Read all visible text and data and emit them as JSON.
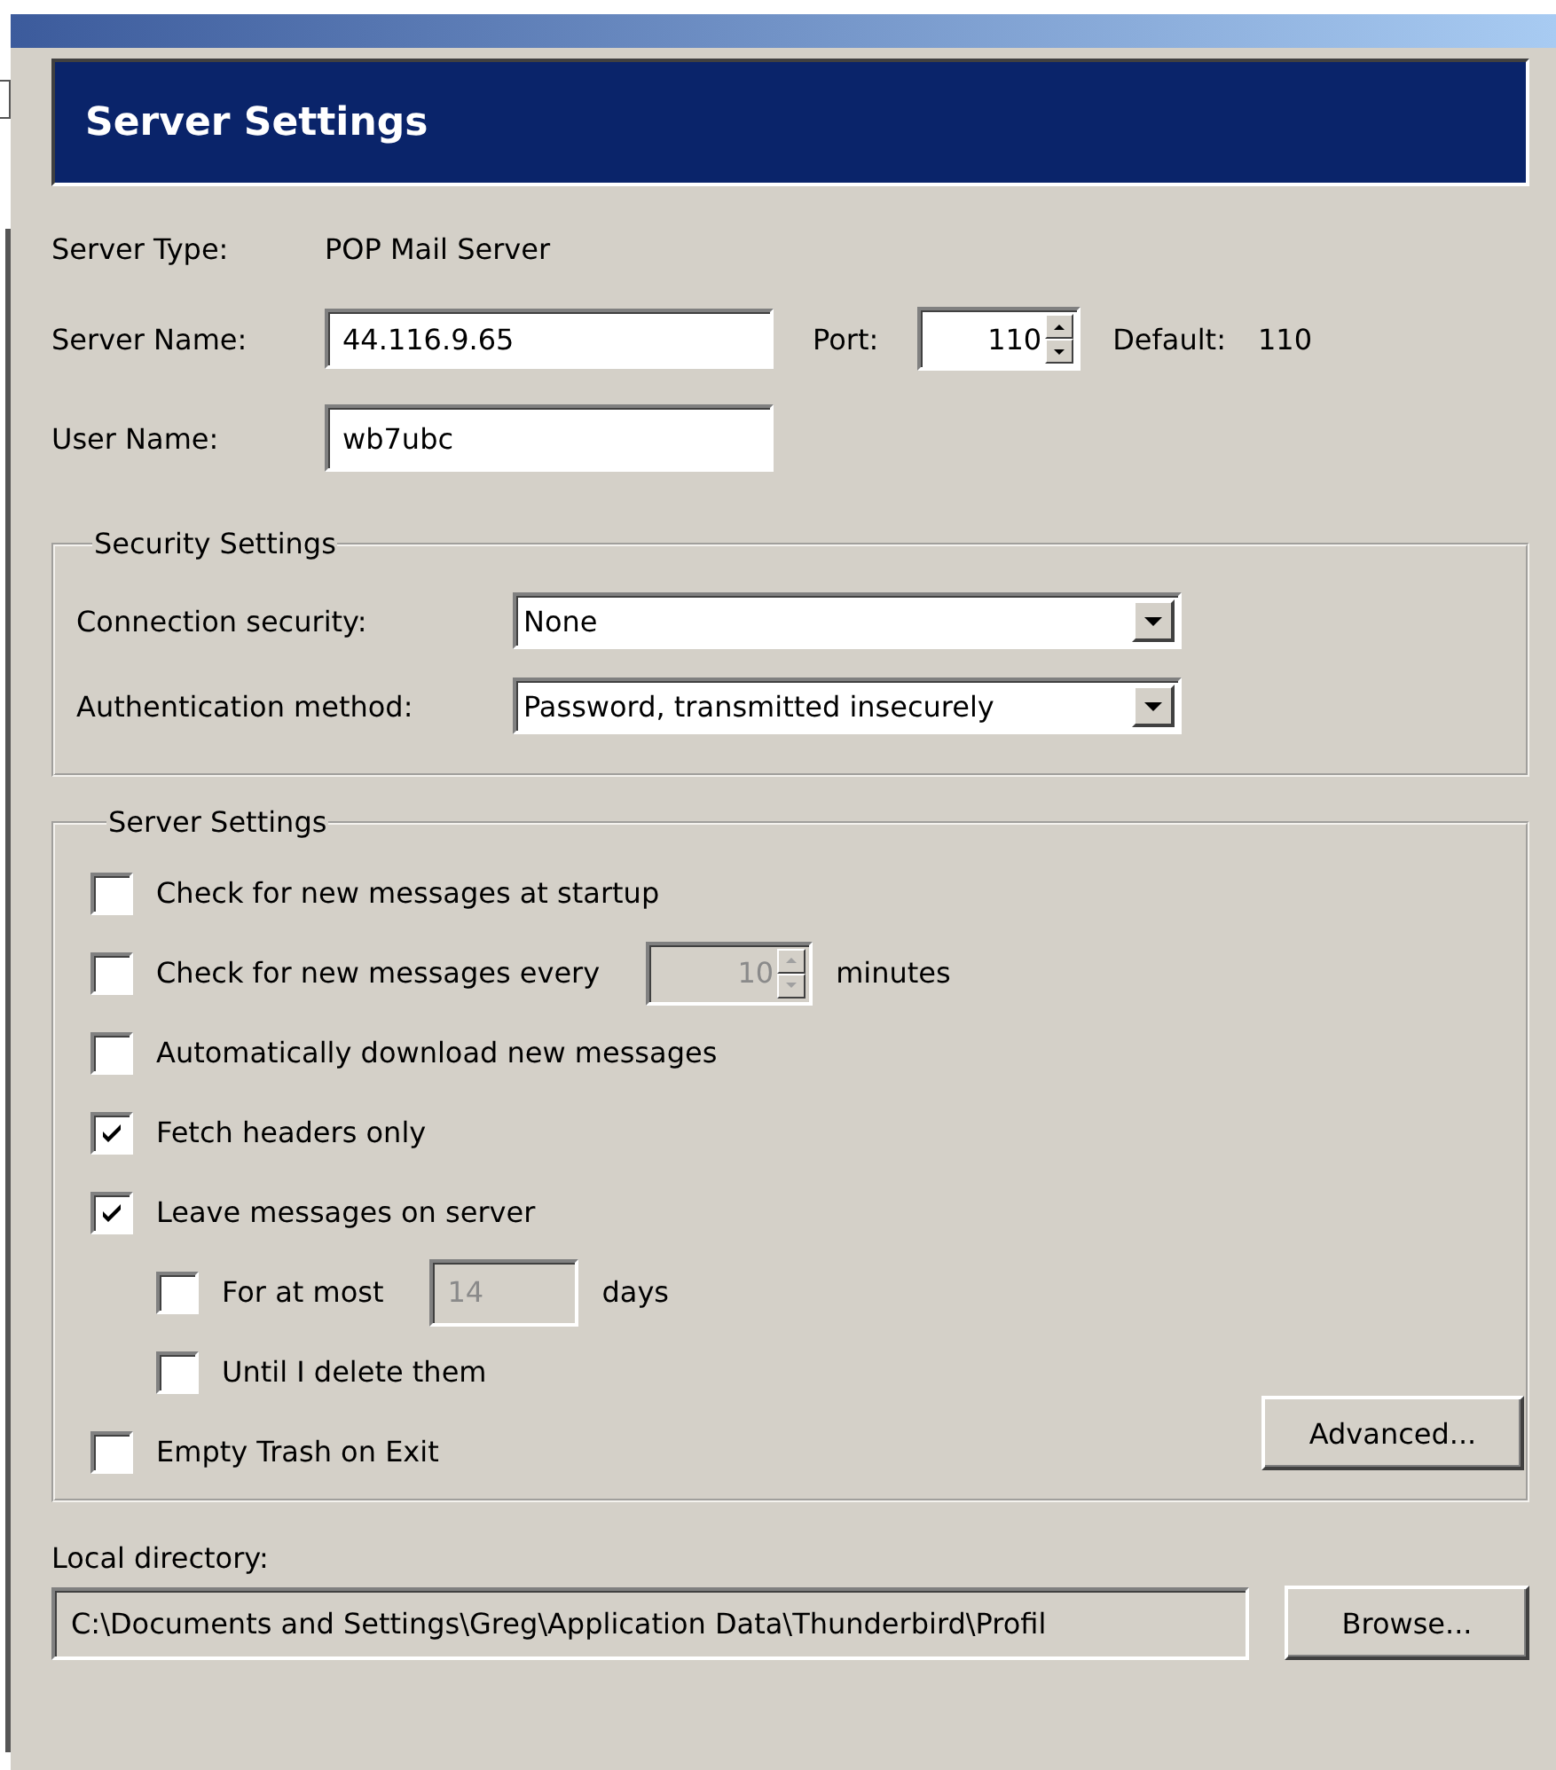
{
  "header": {
    "title": "Server Settings"
  },
  "server": {
    "type_label": "Server Type:",
    "type_value": "POP Mail Server",
    "name_label": "Server Name:",
    "name_value": "44.116.9.65",
    "port_label": "Port:",
    "port_value": "110",
    "default_label": "Default:",
    "default_value": "110",
    "user_label": "User Name:",
    "user_value": "wb7ubc"
  },
  "security": {
    "legend": "Security Settings",
    "fields": [
      {
        "label": "Connection security:",
        "value": "None"
      },
      {
        "label": "Authentication method:",
        "value": "Password, transmitted insecurely"
      }
    ]
  },
  "server_settings": {
    "legend": "Server Settings",
    "options": [
      {
        "kind": "plain",
        "label": "Check for new messages at startup",
        "checked": false
      },
      {
        "kind": "spinner",
        "label": "Check for new messages every",
        "checked": false,
        "input": {
          "value": "10",
          "disabled": true
        },
        "unit": "minutes"
      },
      {
        "kind": "plain",
        "label": "Automatically download new messages",
        "checked": false
      },
      {
        "kind": "plain",
        "label": "Fetch headers only",
        "checked": true
      },
      {
        "kind": "plain",
        "label": "Leave messages on server",
        "checked": true,
        "children": [
          {
            "kind": "field",
            "label": "For at most",
            "checked": false,
            "input": {
              "value": "14",
              "disabled": true
            },
            "unit": "days"
          },
          {
            "kind": "plain",
            "label": "Until I delete them",
            "checked": false
          }
        ]
      },
      {
        "kind": "plain",
        "label": "Empty Trash on Exit",
        "checked": false
      }
    ],
    "advanced_button": "Advanced..."
  },
  "local_directory": {
    "label": "Local directory:",
    "value": "C:\\Documents and Settings\\Greg\\Application Data\\Thunderbird\\Profil",
    "button": "Browse..."
  }
}
